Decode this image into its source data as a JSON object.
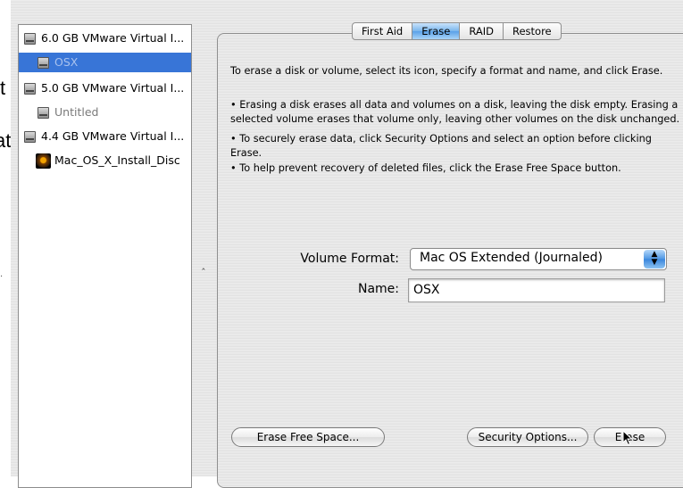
{
  "edge_artifacts": {
    "glyph_1": "t",
    "glyph_2": "at",
    "dot": "·"
  },
  "sidebar": {
    "items": [
      {
        "label": "6.0 GB VMware Virtual I...",
        "type": "disk"
      },
      {
        "label": "OSX",
        "type": "volume",
        "selected": true
      },
      {
        "label": "5.0 GB VMware Virtual I...",
        "type": "disk"
      },
      {
        "label": "Untitled",
        "type": "volume"
      },
      {
        "label": "4.4 GB VMware Virtual I...",
        "type": "disk"
      },
      {
        "label": "Mac_OS_X_Install_Disc",
        "type": "disc-volume"
      }
    ]
  },
  "splitter": {
    "glyph": "‸"
  },
  "tabs": [
    {
      "label": "First Aid",
      "active": false
    },
    {
      "label": "Erase",
      "active": true
    },
    {
      "label": "RAID",
      "active": false
    },
    {
      "label": "Restore",
      "active": false
    }
  ],
  "erase": {
    "intro": "To erase a disk or volume, select its icon, specify a format and name, and click Erase.",
    "bullets": [
      "• Erasing a disk erases all data and volumes on a disk, leaving the disk empty. Erasing a",
      "selected volume erases that volume only, leaving other volumes on the disk unchanged.",
      "• To securely erase data, click Security Options and select an option before clicking",
      "Erase.",
      "• To help prevent recovery of deleted files, click the Erase Free Space button."
    ],
    "volume_format_label": "Volume Format:",
    "volume_format_value": "Mac OS Extended (Journaled)",
    "name_label": "Name:",
    "name_value": "OSX",
    "erase_free_space_button": "Erase Free Space...",
    "security_options_button": "Security Options...",
    "erase_button": "Erase"
  },
  "colors": {
    "selection": "#3875d7",
    "active_tab": "#5aa1e8"
  }
}
